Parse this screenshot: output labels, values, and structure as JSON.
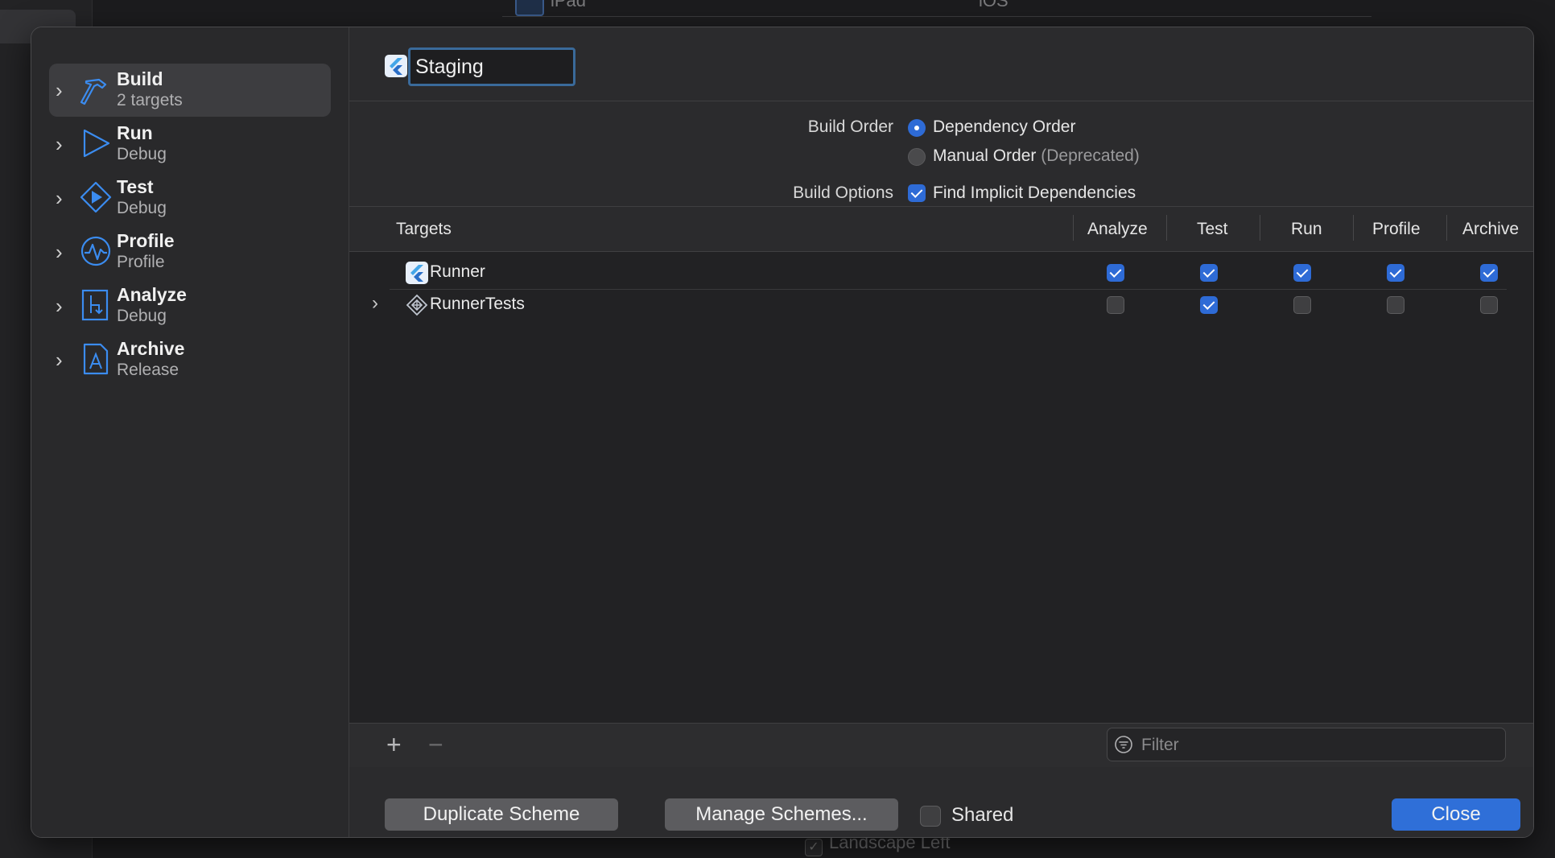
{
  "background": {
    "top_row_name": "iPad",
    "top_row_platform": "iOS",
    "bottom_checkbox_label": "Landscape Left"
  },
  "sidebar": {
    "items": [
      {
        "title": "Build",
        "subtitle": "2 targets",
        "icon": "hammer-icon",
        "selected": true
      },
      {
        "title": "Run",
        "subtitle": "Debug",
        "icon": "play-icon",
        "selected": false
      },
      {
        "title": "Test",
        "subtitle": "Debug",
        "icon": "test-diamond-icon",
        "selected": false
      },
      {
        "title": "Profile",
        "subtitle": "Profile",
        "icon": "waveform-icon",
        "selected": false
      },
      {
        "title": "Analyze",
        "subtitle": "Debug",
        "icon": "analyze-icon",
        "selected": false
      },
      {
        "title": "Archive",
        "subtitle": "Release",
        "icon": "archive-icon",
        "selected": false
      }
    ]
  },
  "scheme": {
    "name": "Staging",
    "icon": "flutter-icon"
  },
  "options": {
    "build_order_label": "Build Order",
    "dependency_order": "Dependency Order",
    "manual_order": "Manual Order",
    "manual_order_note": "(Deprecated)",
    "selected_order": "dependency",
    "build_options_label": "Build Options",
    "find_implicit": "Find Implicit Dependencies",
    "find_implicit_checked": true
  },
  "targets": {
    "columns": [
      "Targets",
      "Analyze",
      "Test",
      "Run",
      "Profile",
      "Archive"
    ],
    "rows": [
      {
        "name": "Runner",
        "icon": "flutter-icon",
        "expandable": false,
        "checks": [
          true,
          true,
          true,
          true,
          true
        ]
      },
      {
        "name": "RunnerTests",
        "icon": "test-bundle-icon",
        "expandable": true,
        "checks": [
          false,
          true,
          false,
          false,
          false
        ]
      }
    ]
  },
  "toolbar": {
    "add_icon": "plus-icon",
    "remove_icon": "minus-icon",
    "filter_placeholder": "Filter"
  },
  "footer": {
    "duplicate_label": "Duplicate Scheme",
    "manage_label": "Manage Schemes...",
    "shared_label": "Shared",
    "shared_checked": false,
    "close_label": "Close"
  },
  "colors": {
    "accent": "#2f6fd8",
    "icon_blue": "#3b8cf0"
  }
}
